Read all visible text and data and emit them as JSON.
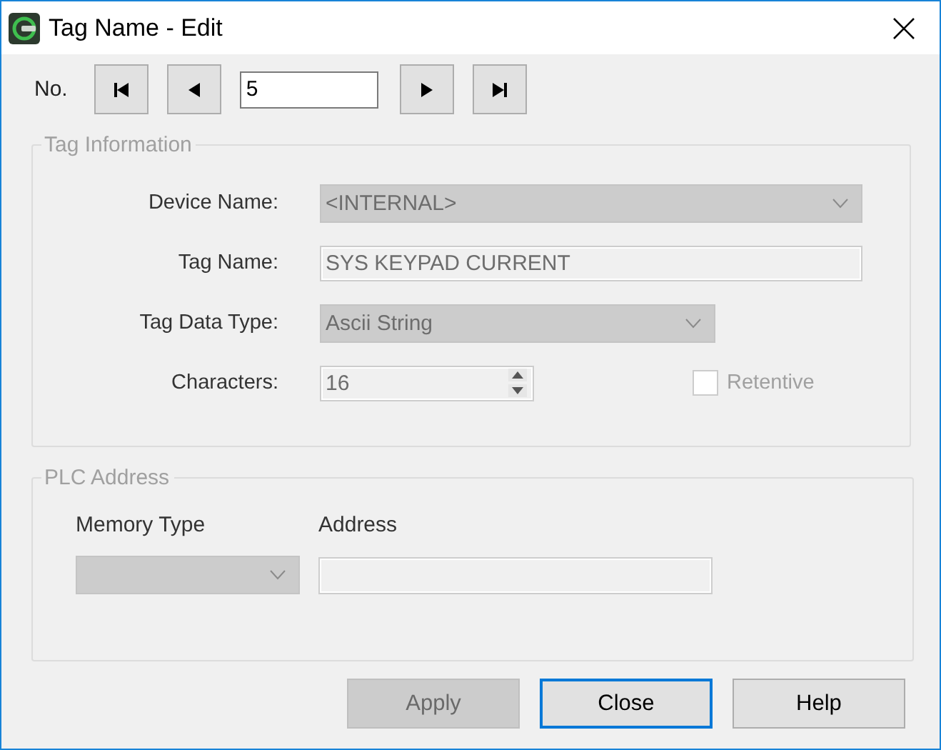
{
  "window": {
    "title": "Tag Name - Edit"
  },
  "navigator": {
    "label": "No.",
    "items": [
      {
        "kind": "first"
      },
      {
        "kind": "previous"
      },
      {
        "kind": "field",
        "value": "5"
      },
      {
        "kind": "next"
      },
      {
        "kind": "last"
      }
    ]
  },
  "tag_information": {
    "title": "Tag Information",
    "fields": [
      {
        "kind": "dropdown",
        "label": "Device Name:",
        "value": "<INTERNAL>",
        "disabled": true
      },
      {
        "kind": "text",
        "label": "Tag Name:",
        "value": "SYS KEYPAD CURRENT",
        "disabled": true
      },
      {
        "kind": "dropdown",
        "label": "Tag Data Type:",
        "value": "Ascii String",
        "disabled": true
      },
      {
        "kind": "spinner",
        "label": "Characters:",
        "value": "16",
        "disabled": true
      }
    ],
    "checkbox": {
      "label": "Retentive",
      "checked": false,
      "disabled": true
    }
  },
  "plc_address": {
    "title": "PLC Address",
    "memory_type": {
      "label": "Memory Type",
      "disabled": true
    },
    "address": {
      "label": "Address",
      "disabled": true
    }
  },
  "buttons": [
    {
      "label": "Apply",
      "disabled": true,
      "focused": false
    },
    {
      "label": "Close",
      "disabled": false,
      "focused": true
    },
    {
      "label": "Help",
      "disabled": false,
      "focused": false
    }
  ]
}
